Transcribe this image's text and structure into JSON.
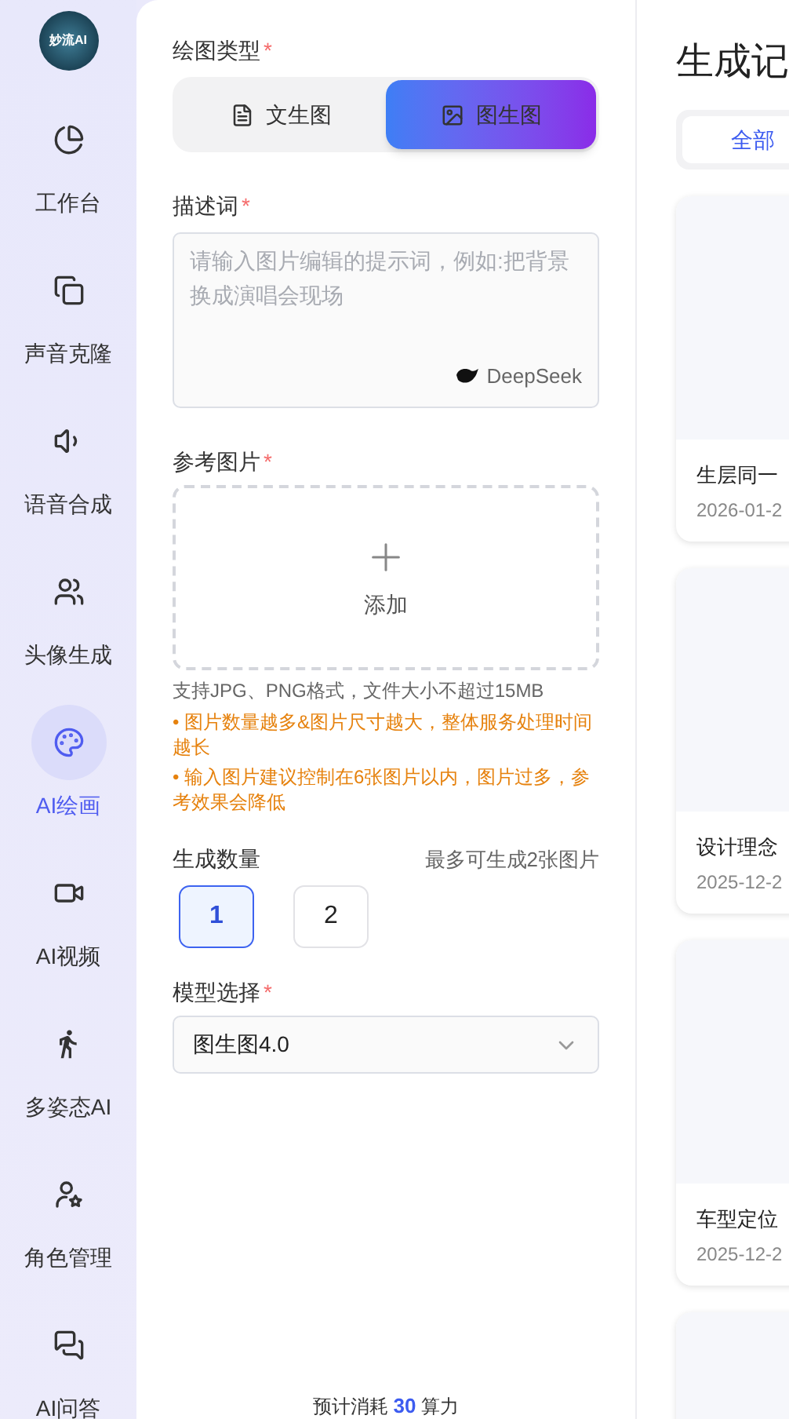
{
  "logo": {
    "text": "妙流AI"
  },
  "sidebar": {
    "items": [
      {
        "label": "工作台",
        "selected": false
      },
      {
        "label": "声音克隆",
        "selected": false
      },
      {
        "label": "语音合成",
        "selected": false
      },
      {
        "label": "头像生成",
        "selected": false
      },
      {
        "label": "AI绘画",
        "selected": true
      },
      {
        "label": "AI视频",
        "selected": false
      },
      {
        "label": "多姿态AI",
        "selected": false
      },
      {
        "label": "角色管理",
        "selected": false
      },
      {
        "label": "AI问答",
        "selected": false
      }
    ]
  },
  "form": {
    "type_label": "绘图类型",
    "type_mark": "*",
    "type_options": [
      {
        "label": "文生图",
        "selected": false
      },
      {
        "label": "图生图",
        "selected": true
      }
    ],
    "prompt_label": "描述词",
    "prompt_mark": "*",
    "prompt_placeholder": "请输入图片编辑的提示词，例如:把背景换成演唱会现场",
    "prompt_badge": "DeepSeek",
    "reference_label": "参考图片",
    "reference_mark": "*",
    "upload_text": "添加",
    "upload_hint": "支持JPG、PNG格式，文件大小不超过15MB",
    "notes": [
      "• 图片数量越多&图片尺寸越大，整体服务处理时间越长",
      "• 输入图片建议控制在6张图片以内，图片过多，参考效果会降低"
    ],
    "count_label": "生成数量",
    "count_hint": "最多可生成2张图片",
    "counts": [
      {
        "label": "1",
        "selected": true
      },
      {
        "label": "2",
        "selected": false
      }
    ],
    "model_label": "模型选择",
    "model_mark": "*",
    "model_value": "图生图4.0",
    "cost_prefix": "预计消耗",
    "cost_value": "30",
    "cost_unit": "算力"
  },
  "records": {
    "title": "生成记",
    "tabs": [
      {
        "label": "全部",
        "selected": true
      }
    ],
    "items": [
      {
        "kind": "record",
        "title": "生层同一",
        "date": "2026-01-2"
      },
      {
        "kind": "record",
        "title": "设计理念",
        "date": "2025-12-2"
      },
      {
        "kind": "record",
        "title": "车型定位",
        "date": "2025-12-2"
      },
      {
        "kind": "blank"
      }
    ]
  }
}
